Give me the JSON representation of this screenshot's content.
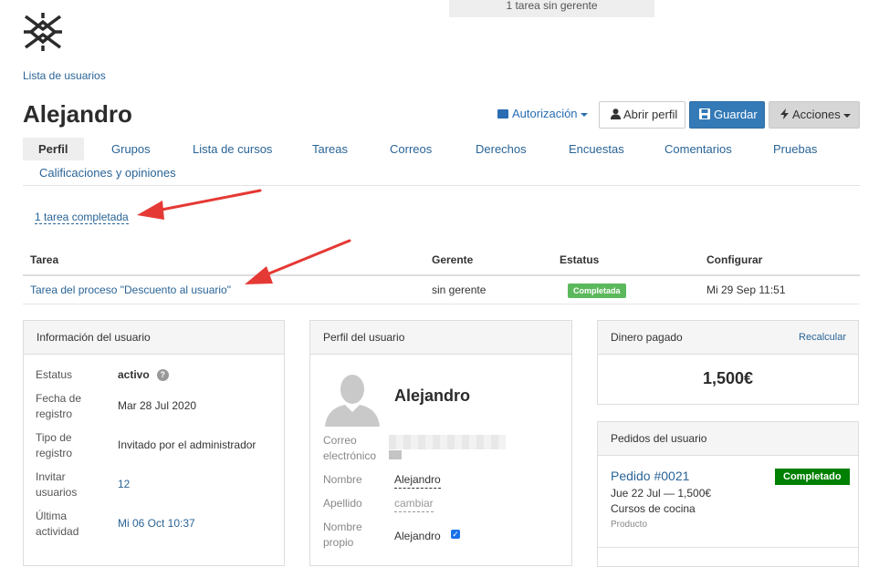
{
  "notice": "1 tarea sin gerente",
  "breadcrumb": "Lista de usuarios",
  "user_name": "Alejandro",
  "buttons": {
    "authorization": "Autorización",
    "open_profile": "Abrir perfil",
    "save": "Guardar",
    "actions": "Acciones"
  },
  "tabs": [
    "Perfil",
    "Grupos",
    "Lista de cursos",
    "Tareas",
    "Correos",
    "Derechos",
    "Encuestas",
    "Comentarios",
    "Pruebas",
    "Calificaciones y opiniones"
  ],
  "completed_tasks_link": "1 tarea completada",
  "task_table": {
    "headers": [
      "Tarea",
      "Gerente",
      "Estatus",
      "Configurar"
    ],
    "rows": [
      {
        "task": "Tarea del proceso \"Descuento al usuario\"",
        "manager": "sin gerente",
        "status": "Completada",
        "configured": "Mi 29 Sep 11:51"
      }
    ]
  },
  "user_info": {
    "title": "Información del usuario",
    "status_label": "Estatus",
    "status_value": "activo",
    "reg_date_label": "Fecha de registro",
    "reg_date_value": "Mar 28 Jul 2020",
    "reg_type_label": "Tipo de registro",
    "reg_type_value": "Invitado por el administrador",
    "invite_label": "Invitar usuarios",
    "invite_value": "12",
    "last_activity_label": "Última actividad",
    "last_activity_value": "Mi 06 Oct 10:37"
  },
  "user_profile": {
    "title": "Perfil del usuario",
    "name_heading": "Alejandro",
    "email_label": "Correo electrónico",
    "first_name_label": "Nombre",
    "first_name_value": "Alejandro",
    "last_name_label": "Apellido",
    "last_name_value": "cambiar",
    "own_name_label": "Nombre propio",
    "own_name_value": "Alejandro"
  },
  "money": {
    "title": "Dinero pagado",
    "recalc": "Recalcular",
    "amount": "1,500€"
  },
  "orders": {
    "title": "Pedidos del usuario",
    "items": [
      {
        "number": "Pedido #0021",
        "status": "Completado",
        "date_total": "Jue 22 Jul — 1,500€",
        "product_name": "Cursos de cocina",
        "product_label": "Producto"
      }
    ]
  },
  "colors": {
    "primary": "#337ab7",
    "link": "#2a6496",
    "success": "#5cb85c",
    "order_success": "#008000",
    "arrow": "#e53935"
  }
}
